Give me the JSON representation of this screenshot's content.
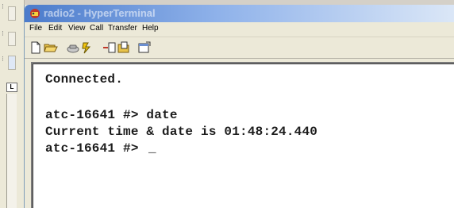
{
  "window": {
    "title": "radio2 - HyperTerminal"
  },
  "menu": {
    "items": [
      {
        "label": "File"
      },
      {
        "label": "Edit"
      },
      {
        "label": "View"
      },
      {
        "label": "Call"
      },
      {
        "label": "Transfer"
      },
      {
        "label": "Help"
      }
    ]
  },
  "toolbar": {
    "buttons": [
      {
        "icon": "new-document-icon"
      },
      {
        "icon": "open-folder-icon"
      },
      {
        "icon": "call-icon"
      },
      {
        "icon": "disconnect-icon"
      },
      {
        "icon": "send-icon"
      },
      {
        "icon": "receive-icon"
      },
      {
        "icon": "properties-icon"
      }
    ]
  },
  "left_strip": {
    "ruler_corner_label": "L"
  },
  "terminal": {
    "lines": [
      "Connected.",
      "",
      "atc-16641 #> date",
      "Current time & date is 01:48:24.440",
      "atc-16641 #> "
    ],
    "cursor": "_"
  },
  "colors": {
    "title_bar_start": "#4b7bcb",
    "title_bar_end": "#dbe7f7",
    "terminal_bg": "#ffffff",
    "terminal_text": "#1c1c1c",
    "chrome": "#ece9d8"
  }
}
